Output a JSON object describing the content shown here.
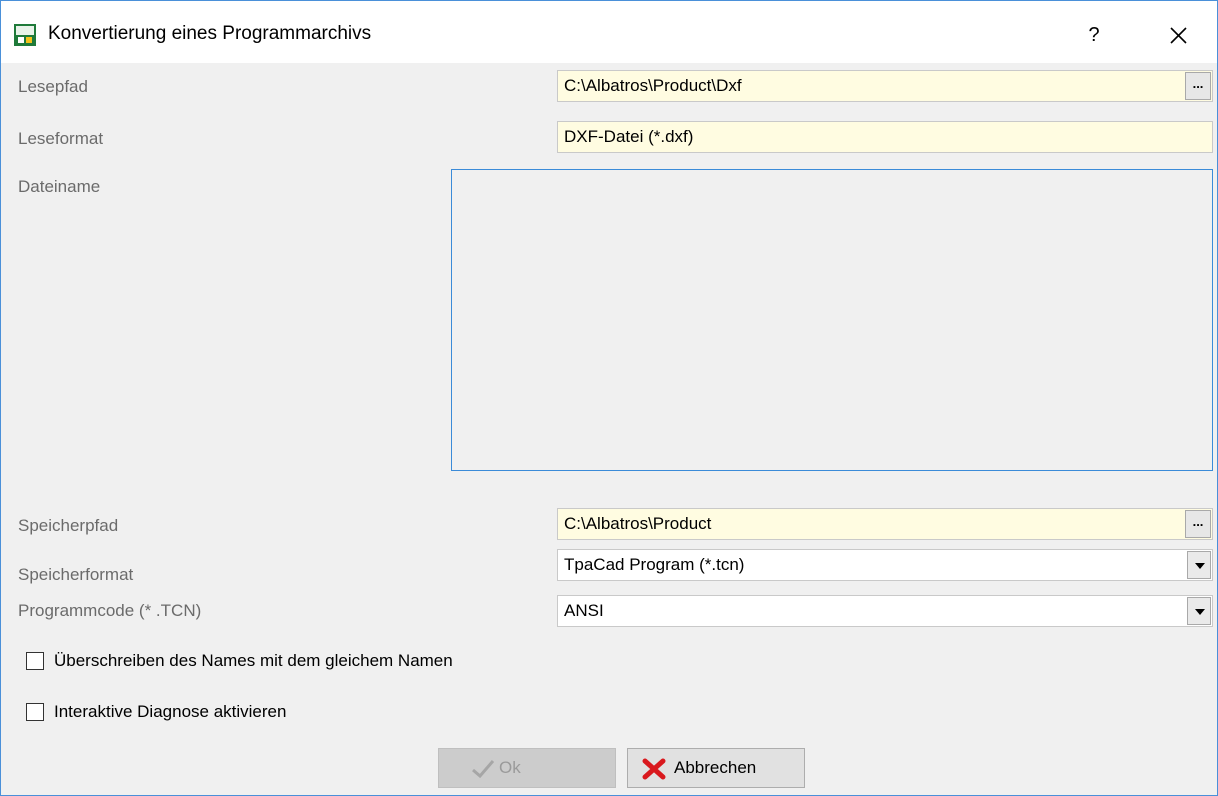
{
  "window": {
    "title": "Konvertierung eines Programmarchivs",
    "help_label": "?",
    "close_icon": "close-icon",
    "app_icon": "tpacad-app-icon"
  },
  "form": {
    "read_path": {
      "label": "Lesepfad",
      "value": "C:\\Albatros\\Product\\Dxf",
      "browse_label": "..."
    },
    "read_format": {
      "label": "Leseformat",
      "value": "DXF-Datei (*.dxf)"
    },
    "file_name": {
      "label": "Dateiname"
    },
    "save_path": {
      "label": "Speicherpfad",
      "value": "C:\\Albatros\\Product",
      "browse_label": "..."
    },
    "save_format": {
      "label": "Speicherformat",
      "value": "TpaCad Program (*.tcn)"
    },
    "program_code": {
      "label": "Programmcode (* .TCN)",
      "value": "ANSI"
    }
  },
  "options": {
    "overwrite": {
      "label": "Überschreiben des Names mit dem gleichem Namen",
      "checked": false
    },
    "diagnose": {
      "label": "Interaktive Diagnose aktivieren",
      "checked": false
    }
  },
  "buttons": {
    "ok": {
      "label": "Ok",
      "enabled": false,
      "icon": "check-icon"
    },
    "cancel": {
      "label": "Abbrechen",
      "enabled": true,
      "icon": "red-x-icon"
    }
  },
  "colors": {
    "field_background": "#fffce1",
    "accent_border": "#3b8bd8"
  }
}
